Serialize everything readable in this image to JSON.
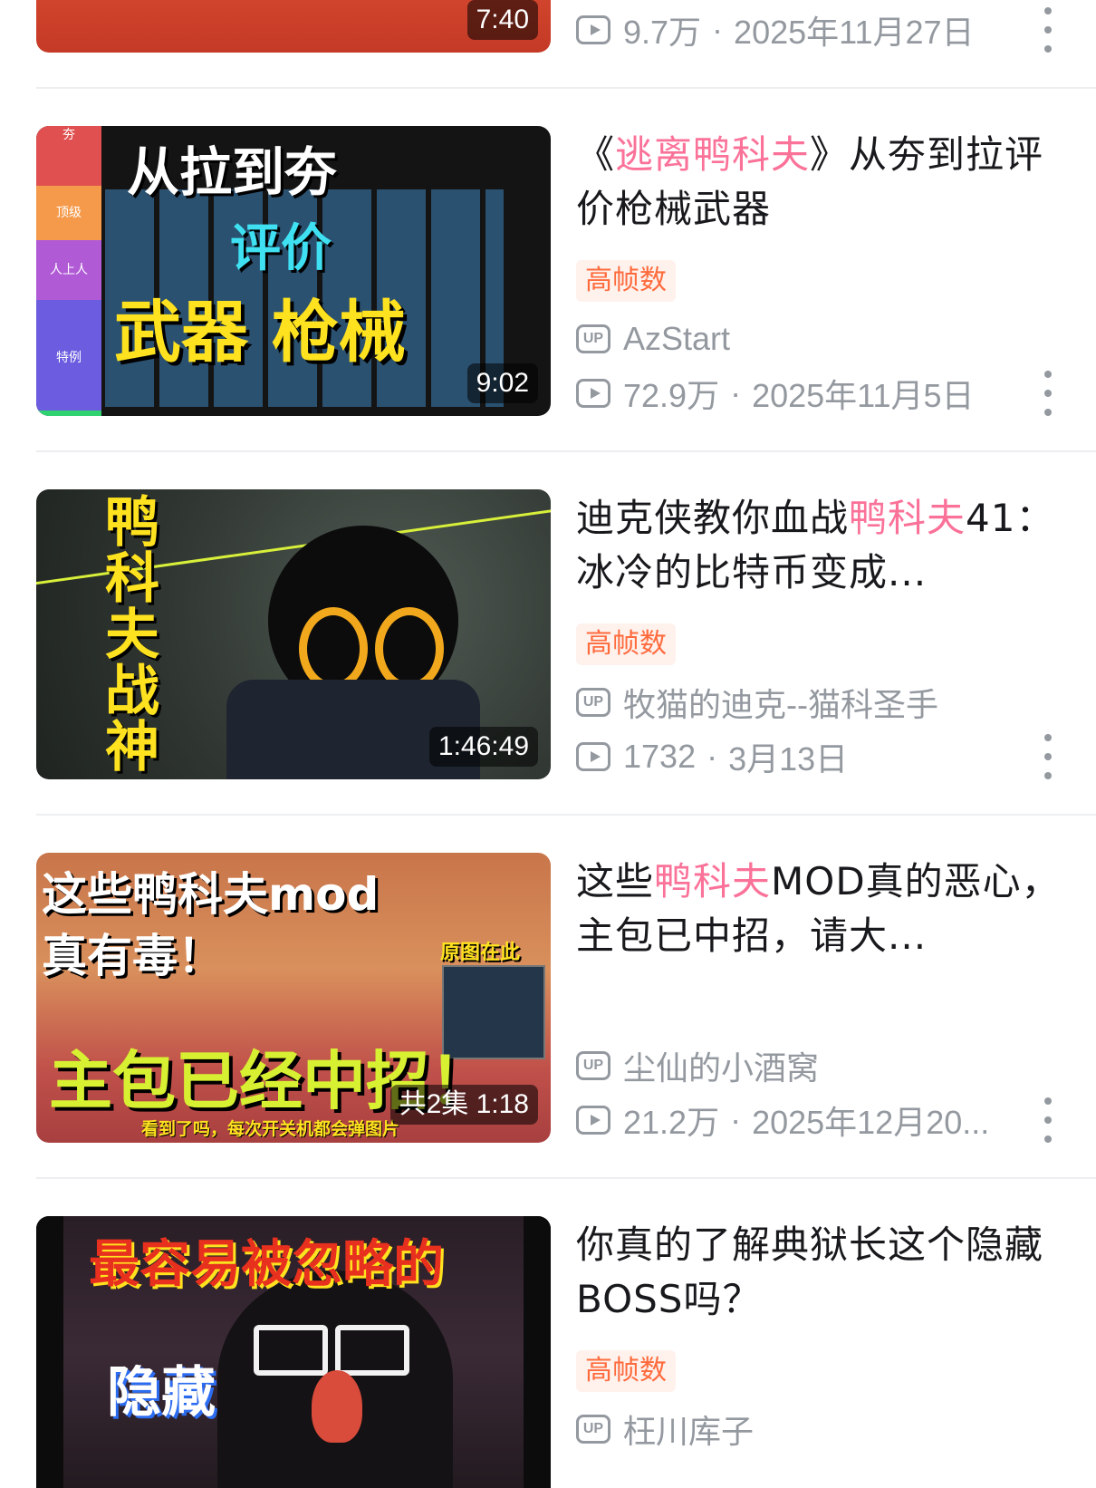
{
  "feed": {
    "items": [
      {
        "duration": "7:40",
        "views": "9.7万",
        "date": "2025年11月27日"
      },
      {
        "title_pre": "《",
        "title_hl": "逃离鸭科夫",
        "title_post": "》从夯到拉评价枪械武器",
        "badge": "高帧数",
        "uploader": "AzStart",
        "views": "72.9万",
        "date": "2025年11月5日",
        "duration": "9:02",
        "thumb_text": {
          "header": "从拉到夯",
          "sub": "评价",
          "main": "武器 枪械",
          "tiers": [
            "夯",
            "顶级",
            "人上人",
            "特例"
          ]
        }
      },
      {
        "title_pre": "迪克侠教你血战",
        "title_hl": "鸭科夫",
        "title_post": "41：冰冷的比特币变成...",
        "badge": "高帧数",
        "uploader": "牧猫的迪克--猫科圣手",
        "views": "1732",
        "date": "3月13日",
        "duration": "1:46:49",
        "thumb_text": {
          "vertical": "鸭科夫战神"
        }
      },
      {
        "title_pre": "这些",
        "title_hl": "鸭科夫",
        "title_post": "MOD真的恶心，主包已中招，请大...",
        "uploader": "尘仙的小酒窝",
        "views": "21.2万",
        "date": "2025年12月20...",
        "duration": "共2集 1:18",
        "thumb_text": {
          "line1": "这些鸭科夫mod",
          "line2": "真有毒！",
          "corner": "原图在此",
          "main": "主包已经中招！",
          "caption": "看到了吗，每次开关机都会弹图片"
        }
      },
      {
        "title_pre": "你真的了解典狱长这个隐藏BOSS吗？",
        "title_hl": "",
        "title_post": "",
        "badge": "高帧数",
        "uploader": "枉川库子",
        "thumb_text": {
          "top": "最容易被忽略的",
          "mid": "隐藏"
        }
      }
    ]
  },
  "icons": {
    "play": "play-count-icon",
    "up": "uploader-icon",
    "more": "more-icon"
  },
  "colors": {
    "highlight": "#fb7299",
    "badge_text": "#ff6b3d",
    "badge_bg": "#fff1ec",
    "meta": "#9499a0"
  }
}
